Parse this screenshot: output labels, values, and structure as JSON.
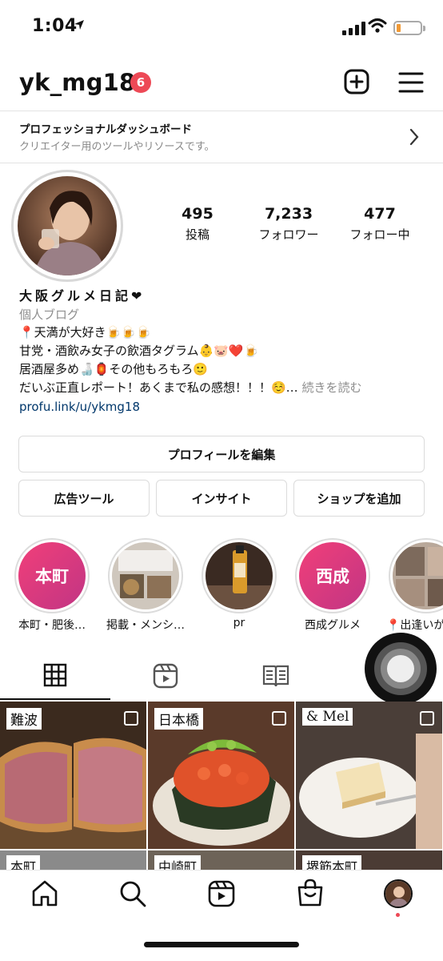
{
  "status": {
    "time": "1:04"
  },
  "profile": {
    "username": "yk_mg18",
    "notif_count": "6"
  },
  "dashboard": {
    "title": "プロフェッショナルダッシュボード",
    "subtitle": "クリエイター用のツールやリソースです。"
  },
  "stats": [
    {
      "value": "495",
      "label": "投稿"
    },
    {
      "value": "7,233",
      "label": "フォロワー"
    },
    {
      "value": "477",
      "label": "フォロー中"
    }
  ],
  "bio": {
    "name": "大阪グルメ日記❤",
    "category": "個人ブログ",
    "lines": [
      "📍天満が大好き🍺🍺🍺",
      "甘党・酒飲み女子の飲酒タグラム👶🐷❤️🍺",
      "居酒屋多め🍶🏮その他もろもろ🙂",
      "だいぶ正直レポート！あくまで私の感想！！！☺️…"
    ],
    "more": "続きを読む",
    "link": "profu.link/u/ykmg18"
  },
  "buttons": {
    "edit_profile": "プロフィールを編集",
    "ad_tools": "広告ツール",
    "insights": "インサイト",
    "add_shop": "ショップを追加"
  },
  "highlights": [
    {
      "cover_text": "本町",
      "label": "本町・肥後…"
    },
    {
      "cover_text": "",
      "label": "掲載・メンシ…"
    },
    {
      "cover_text": "",
      "label": "pr"
    },
    {
      "cover_text": "西成",
      "label": "西成グルメ"
    },
    {
      "cover_text": "",
      "label": "📍出逢いが"
    }
  ],
  "tabs": [
    "grid-icon",
    "reels-icon",
    "guide-icon",
    "tagged-icon"
  ],
  "grid": [
    {
      "tag": "難波"
    },
    {
      "tag": "日本橋"
    },
    {
      "tag": "& Mel"
    },
    {
      "tag": "本町"
    },
    {
      "tag": "中崎町"
    },
    {
      "tag": "堺筋本町"
    }
  ],
  "nav": [
    "home-icon",
    "search-icon",
    "reels-icon",
    "shop-icon",
    "profile-avatar"
  ],
  "colors": {
    "badge": "#ed4956",
    "link": "#00376b",
    "highlight_gradient_start": "#f13f79",
    "highlight_gradient_end": "#c13584"
  }
}
